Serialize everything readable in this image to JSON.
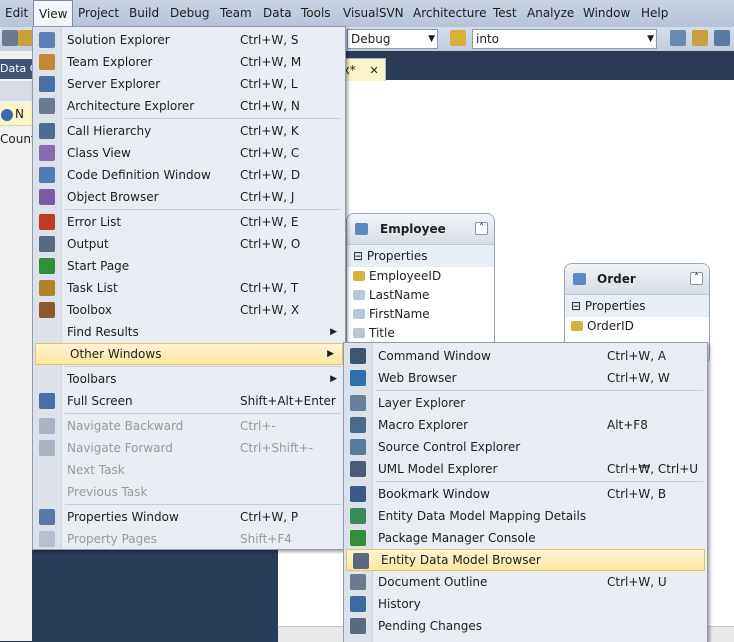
{
  "menubar": [
    "Edit",
    "View",
    "Project",
    "Build",
    "Debug",
    "Team",
    "Data",
    "Tools",
    "VisualSVN",
    "Architecture",
    "Test",
    "Analyze",
    "Window",
    "Help"
  ],
  "toolbar": {
    "config": "Debug",
    "find": "into"
  },
  "left_panel": {
    "title": "Data C",
    "info": "N",
    "count_label": "Count"
  },
  "doc_tab": {
    "label": "nx*",
    "close": "✕"
  },
  "entities": {
    "employee": {
      "title": "Employee",
      "section": "Properties",
      "props": [
        "EmployeeID",
        "LastName",
        "FirstName",
        "Title"
      ]
    },
    "order": {
      "title": "Order",
      "section": "Properties",
      "props": [
        "OrderID"
      ]
    }
  },
  "view_menu": [
    {
      "label": "Solution Explorer",
      "shortcut": "Ctrl+W, S",
      "icon": "solution-explorer-icon",
      "color": "#5c7fb5"
    },
    {
      "label": "Team Explorer",
      "shortcut": "Ctrl+W, M",
      "icon": "team-explorer-icon",
      "color": "#c08a34"
    },
    {
      "label": "Server Explorer",
      "shortcut": "Ctrl+W, L",
      "icon": "server-explorer-icon",
      "color": "#4a6fa5"
    },
    {
      "label": "Architecture Explorer",
      "shortcut": "Ctrl+W, N",
      "icon": "architecture-explorer-icon",
      "color": "#6b7a90"
    },
    {
      "label": "Call Hierarchy",
      "shortcut": "Ctrl+W, K",
      "icon": "call-hierarchy-icon",
      "color": "#506b90",
      "sep": true
    },
    {
      "label": "Class View",
      "shortcut": "Ctrl+W, C",
      "icon": "class-view-icon",
      "color": "#8a6bb3"
    },
    {
      "label": "Code Definition Window",
      "shortcut": "Ctrl+W, D",
      "icon": "code-definition-icon",
      "color": "#4f7bb0"
    },
    {
      "label": "Object Browser",
      "shortcut": "Ctrl+W, J",
      "icon": "object-browser-icon",
      "color": "#7a5aa0"
    },
    {
      "label": "Error List",
      "shortcut": "Ctrl+W, E",
      "icon": "error-list-icon",
      "color": "#c0392b",
      "sep": true
    },
    {
      "label": "Output",
      "shortcut": "Ctrl+W, O",
      "icon": "output-icon",
      "color": "#5a6a80"
    },
    {
      "label": "Start Page",
      "shortcut": "",
      "icon": "start-page-icon",
      "color": "#2f8f3a"
    },
    {
      "label": "Task List",
      "shortcut": "Ctrl+W, T",
      "icon": "task-list-icon",
      "color": "#b0802a"
    },
    {
      "label": "Toolbox",
      "shortcut": "Ctrl+W, X",
      "icon": "toolbox-icon",
      "color": "#8a5a2a"
    },
    {
      "label": "Find Results",
      "shortcut": "",
      "icon": "",
      "color": "",
      "submenu": true
    },
    {
      "label": "Other Windows",
      "shortcut": "",
      "icon": "",
      "color": "",
      "submenu": true,
      "highlighted": true
    },
    {
      "label": "Toolbars",
      "shortcut": "",
      "icon": "",
      "color": "",
      "submenu": true,
      "sep": true
    },
    {
      "label": "Full Screen",
      "shortcut": "Shift+Alt+Enter",
      "icon": "full-screen-icon",
      "color": "#4a6fa5"
    },
    {
      "label": "Navigate Backward",
      "shortcut": "Ctrl+-",
      "icon": "navigate-backward-icon",
      "color": "#6a7a90",
      "disabled": true,
      "sep": true
    },
    {
      "label": "Navigate Forward",
      "shortcut": "Ctrl+Shift+-",
      "icon": "navigate-forward-icon",
      "color": "#6a7a90",
      "disabled": true
    },
    {
      "label": "Next Task",
      "shortcut": "",
      "icon": "",
      "color": "",
      "disabled": true
    },
    {
      "label": "Previous Task",
      "shortcut": "",
      "icon": "",
      "color": "",
      "disabled": true
    },
    {
      "label": "Properties Window",
      "shortcut": "Ctrl+W, P",
      "icon": "properties-window-icon",
      "color": "#5a7aa5",
      "sep": true
    },
    {
      "label": "Property Pages",
      "shortcut": "Shift+F4",
      "icon": "property-pages-icon",
      "color": "#8a98ad",
      "disabled": true
    }
  ],
  "other_windows_menu": [
    {
      "label": "Command Window",
      "shortcut": "Ctrl+W, A",
      "icon": "command-window-icon",
      "color": "#3f5670"
    },
    {
      "label": "Web Browser",
      "shortcut": "Ctrl+W, W",
      "icon": "web-browser-icon",
      "color": "#2f6fb0"
    },
    {
      "label": "Layer Explorer",
      "shortcut": "",
      "icon": "layer-explorer-icon",
      "color": "#6a7f9a",
      "sep": true
    },
    {
      "label": "Macro Explorer",
      "shortcut": "Alt+F8",
      "icon": "macro-explorer-icon",
      "color": "#4a6a8a"
    },
    {
      "label": "Source Control Explorer",
      "shortcut": "",
      "icon": "source-control-explorer-icon",
      "color": "#5a7a9a"
    },
    {
      "label": "UML Model Explorer",
      "shortcut": "Ctrl+₩, Ctrl+U",
      "icon": "uml-model-explorer-icon",
      "color": "#4a5a7a"
    },
    {
      "label": "Bookmark Window",
      "shortcut": "Ctrl+W, B",
      "icon": "bookmark-window-icon",
      "color": "#3a5a8a",
      "sep": true
    },
    {
      "label": "Entity Data Model Mapping Details",
      "shortcut": "",
      "icon": "entity-mapping-icon",
      "color": "#3a8a5a"
    },
    {
      "label": "Package Manager Console",
      "shortcut": "",
      "icon": "package-manager-icon",
      "color": "#2f8f3a"
    },
    {
      "label": "Entity Data Model Browser",
      "shortcut": "",
      "icon": "entity-model-browser-icon",
      "color": "#5a6a7a",
      "highlighted": true
    },
    {
      "label": "Document Outline",
      "shortcut": "Ctrl+W, U",
      "icon": "document-outline-icon",
      "color": "#6a7a90"
    },
    {
      "label": "History",
      "shortcut": "",
      "icon": "history-icon",
      "color": "#3a6aa0"
    },
    {
      "label": "Pending Changes",
      "shortcut": "",
      "icon": "pending-changes-icon",
      "color": "#5a6a80"
    }
  ]
}
